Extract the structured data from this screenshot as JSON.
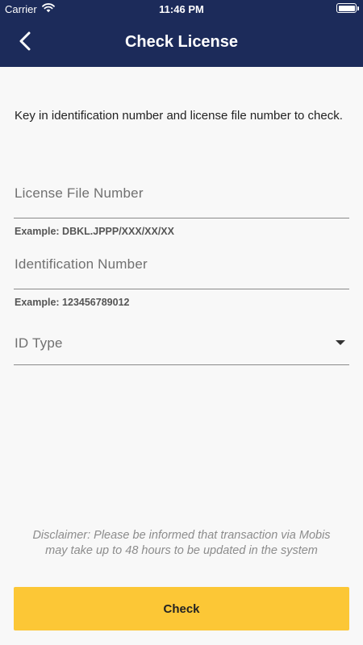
{
  "status_bar": {
    "carrier": "Carrier",
    "time": "11:46 PM"
  },
  "app_bar": {
    "title": "Check License",
    "back_icon": "chevron-left-icon"
  },
  "instruction": "Key in identification number and license file number to check.",
  "form": {
    "license_file_number": {
      "label": "License File Number",
      "example": "Example: DBKL.JPPP/XXX/XX/XX"
    },
    "identification_number": {
      "label": "Identification Number",
      "example": "Example: 123456789012"
    },
    "id_type": {
      "label": "ID Type",
      "icon": "caret-down-icon"
    }
  },
  "disclaimer": "Disclaimer: Please be informed that transaction via Mobis may take up to 48 hours to be updated in the system",
  "check_button": {
    "label": "Check"
  },
  "colors": {
    "header": "#1c2b5a",
    "accent": "#fcc736",
    "background": "#f8f8f8"
  }
}
